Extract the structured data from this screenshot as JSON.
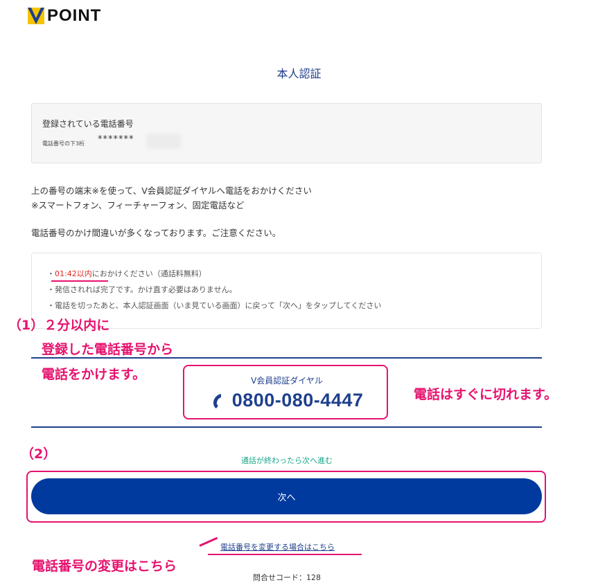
{
  "logo": {
    "text": "POINT",
    "icon": "v-point-logo-icon",
    "colors": {
      "yellow": "#f5c400",
      "blue": "#1e3f8d"
    }
  },
  "page_title": "本人認証",
  "registered_phone": {
    "heading": "登録されている電話番号",
    "last3_label": "電話番号の下3桁",
    "masked": "*******"
  },
  "instructions": {
    "line1": "上の番号の端末※を使って、V会員認証ダイヤルへ電話をおかけください",
    "line2": "※スマートフォン、フィーチャーフォン、固定電話など",
    "line3": "電話番号のかけ間違いが多くなっております。ご注意ください。"
  },
  "notice": {
    "timer": "01:42以内",
    "timer_suffix": "におかけください（通話料無料）",
    "line2": "・発信されれば完了です。かけ直す必要はありません。",
    "line3": "・電話を切ったあと、本人認証画面（いま見ている画面）に戻って「次へ」をタップしてください"
  },
  "dial": {
    "label": "V会員認証ダイヤル",
    "number": "0800-080-4447",
    "icon": "phone-icon"
  },
  "annotations": {
    "step1_line1": "（1）２分以内に",
    "step1_line2": "登録した電話番号から",
    "step1_line3": "電話をかけます。",
    "hangup": "電話はすぐに切れます。",
    "step2": "（2）",
    "change": "電話番号の変更はこちら"
  },
  "next": {
    "note": "通話が終わったら次へ進む",
    "button_label": "次へ"
  },
  "change_link": "電話番号を変更する場合はこちら",
  "inquiry_code": "問合せコード：128",
  "colors": {
    "brand_blue": "#003a9e",
    "annotation_pink": "#e6126e",
    "timer_red": "#e0261f",
    "note_green": "#1aa68c"
  }
}
